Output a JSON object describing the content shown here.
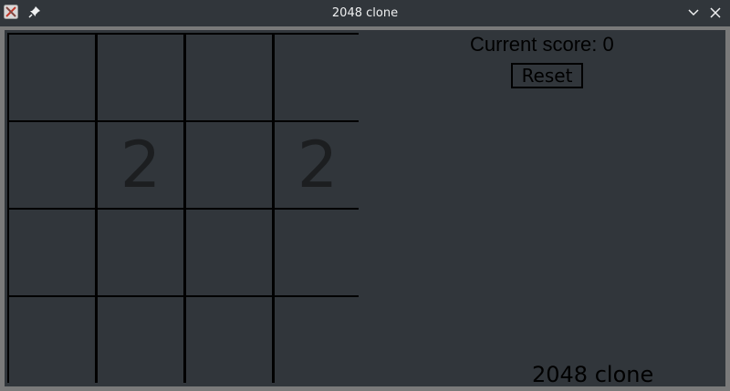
{
  "window": {
    "title": "2048 clone",
    "icons": {
      "app": "app-icon",
      "pin": "pin-icon",
      "minimize": "chevron-down-icon",
      "close": "close-icon"
    }
  },
  "game": {
    "score_label": "Current score: 0",
    "reset_label": "Reset",
    "footer_label": "2048 clone",
    "board": [
      [
        "",
        "",
        "",
        ""
      ],
      [
        "",
        "2",
        "",
        "2"
      ],
      [
        "",
        "",
        "",
        ""
      ],
      [
        "",
        "",
        "",
        ""
      ]
    ]
  },
  "colors": {
    "background": "#31363b",
    "frame": "#7a7a7a",
    "grid_lines": "#000000",
    "tile_text": "#1c1e20"
  }
}
